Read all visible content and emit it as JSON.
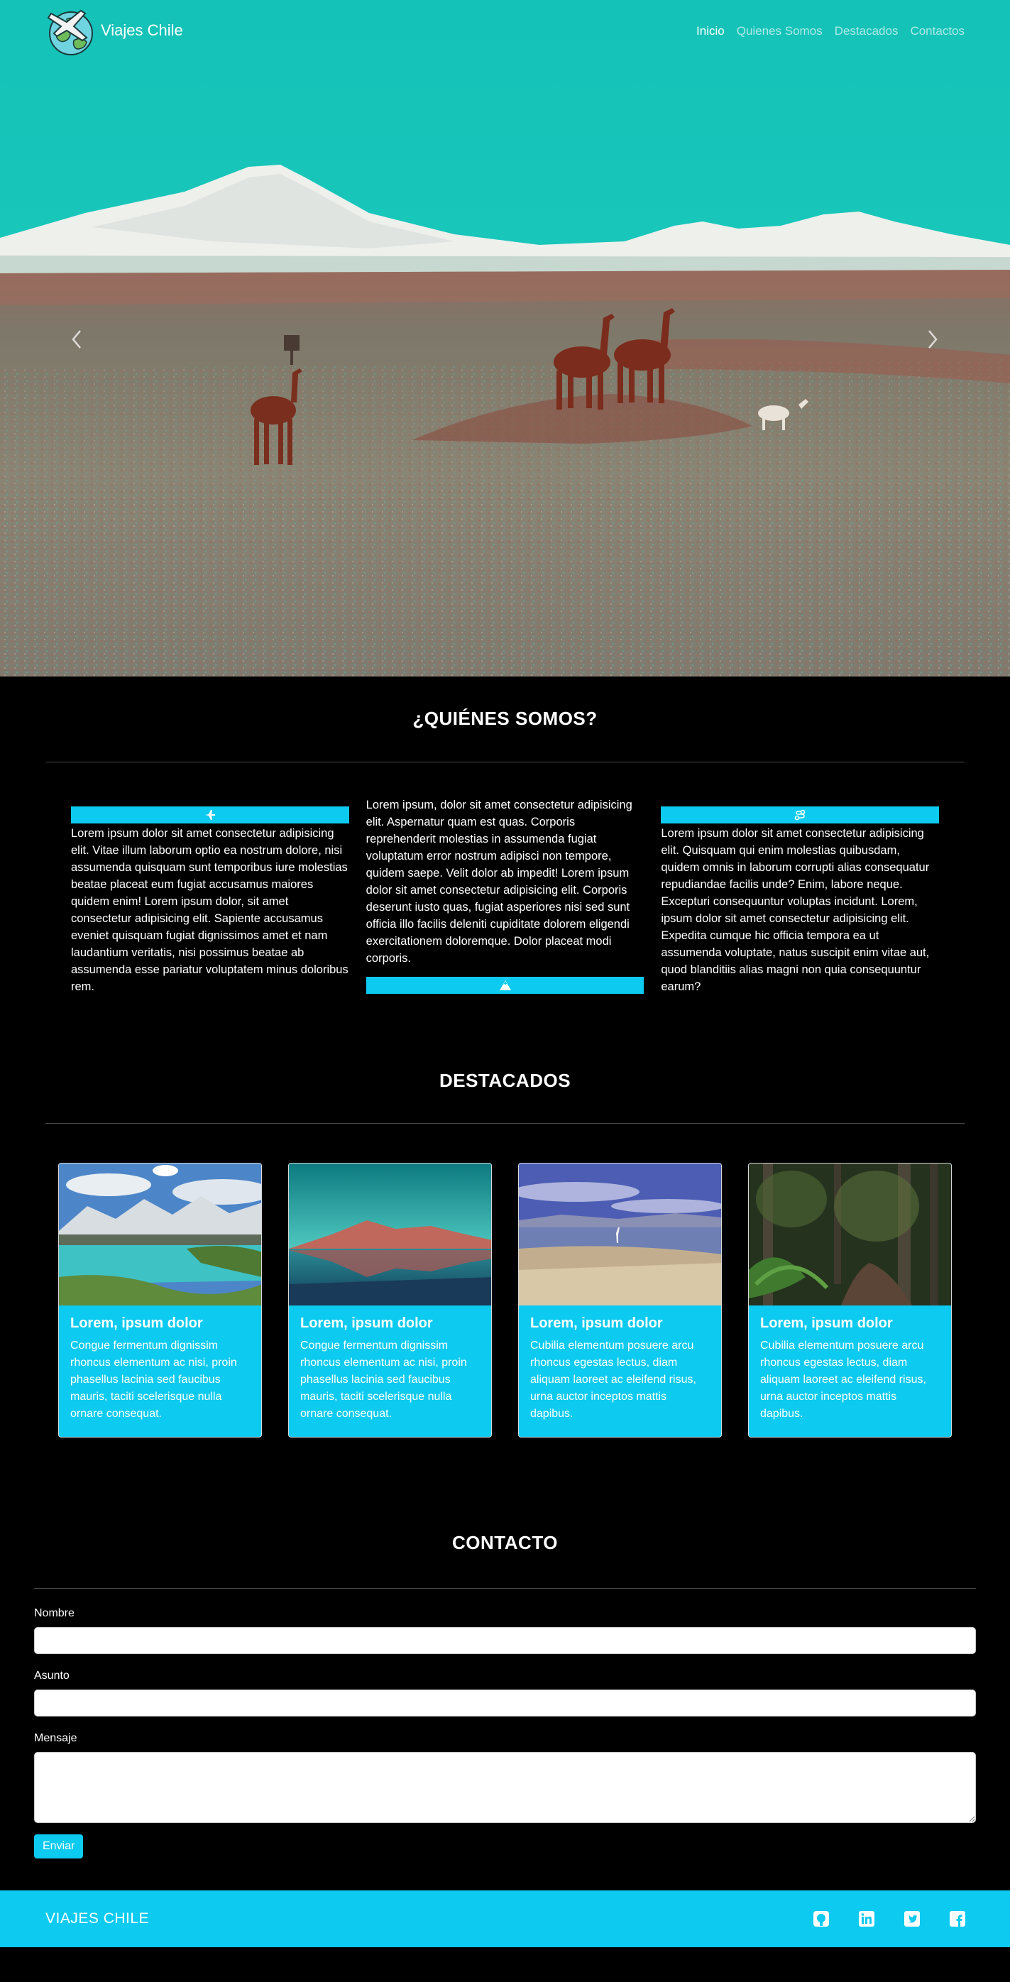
{
  "nav": {
    "brand": "Viajes Chile",
    "links": [
      {
        "label": "Inicio",
        "active": true
      },
      {
        "label": "Quienes Somos",
        "active": false
      },
      {
        "label": "Destacados",
        "active": false
      },
      {
        "label": "Contactos",
        "active": false
      }
    ]
  },
  "about": {
    "title": "¿QUIÉNES SOMOS?",
    "columns": [
      {
        "icon": "airplane-icon",
        "text": "Lorem ipsum dolor sit amet consectetur adipisicing elit. Vitae illum laborum optio ea nostrum dolore, nisi assumenda quisquam sunt temporibus iure molestias beatae placeat eum fugiat accusamus maiores quidem enim! Lorem ipsum dolor, sit amet consectetur adipisicing elit. Sapiente accusamus eveniet quisquam fugiat dignissimos amet et nam laudantium veritatis, nisi possimus beatae ab assumenda esse pariatur voluptatem minus doloribus rem."
      },
      {
        "icon": "mountain-icon",
        "text": "Lorem ipsum, dolor sit amet consectetur adipisicing elit. Aspernatur quam est quas. Corporis reprehenderit molestias in assumenda fugiat voluptatum error nostrum adipisci non tempore, quidem saepe. Velit dolor ab impedit! Lorem ipsum dolor sit amet consectetur adipisicing elit. Corporis deserunt iusto quas, fugiat asperiores nisi sed sunt officia illo facilis deleniti cupiditate dolorem eligendi exercitationem doloremque. Dolor placeat modi corporis."
      },
      {
        "icon": "route-icon",
        "text": "Lorem ipsum dolor sit amet consectetur adipisicing elit. Quisquam qui enim molestias quibusdam, quidem omnis in laborum corrupti alias consequatur repudiandae facilis unde? Enim, labore neque. Excepturi consequuntur voluptas incidunt. Lorem, ipsum dolor sit amet consectetur adipisicing elit. Expedita cumque hic officia tempora ea ut assumenda voluptate, natus suscipit enim vitae aut, quod blanditiis alias magni non quia consequuntur earum?"
      }
    ]
  },
  "featured": {
    "title": "DESTACADOS",
    "cards": [
      {
        "title": "Lorem, ipsum dolor",
        "text": "Congue fermentum dignissim rhoncus elementum ac nisi, proin phasellus lacinia sed faucibus mauris, taciti scelerisque nulla ornare consequat."
      },
      {
        "title": "Lorem, ipsum dolor",
        "text": "Congue fermentum dignissim rhoncus elementum ac nisi, proin phasellus lacinia sed faucibus mauris, taciti scelerisque nulla ornare consequat."
      },
      {
        "title": "Lorem, ipsum dolor",
        "text": "Cubilia elementum posuere arcu rhoncus egestas lectus, diam aliquam laoreet ac eleifend risus, urna auctor inceptos mattis dapibus."
      },
      {
        "title": "Lorem, ipsum dolor",
        "text": "Cubilia elementum posuere arcu rhoncus egestas lectus, diam aliquam laoreet ac eleifend risus, urna auctor inceptos mattis dapibus."
      }
    ]
  },
  "contact": {
    "title": "CONTACTO",
    "fields": {
      "name": "Nombre",
      "subject": "Asunto",
      "message": "Mensaje"
    },
    "submit": "Enviar"
  },
  "footer": {
    "brand": "VIAJES CHILE",
    "social": [
      "github-icon",
      "linkedin-icon",
      "twitter-icon",
      "facebook-icon"
    ]
  },
  "colors": {
    "accent": "#0ccaf0",
    "background": "#000000",
    "sky": "#16bfb5"
  }
}
